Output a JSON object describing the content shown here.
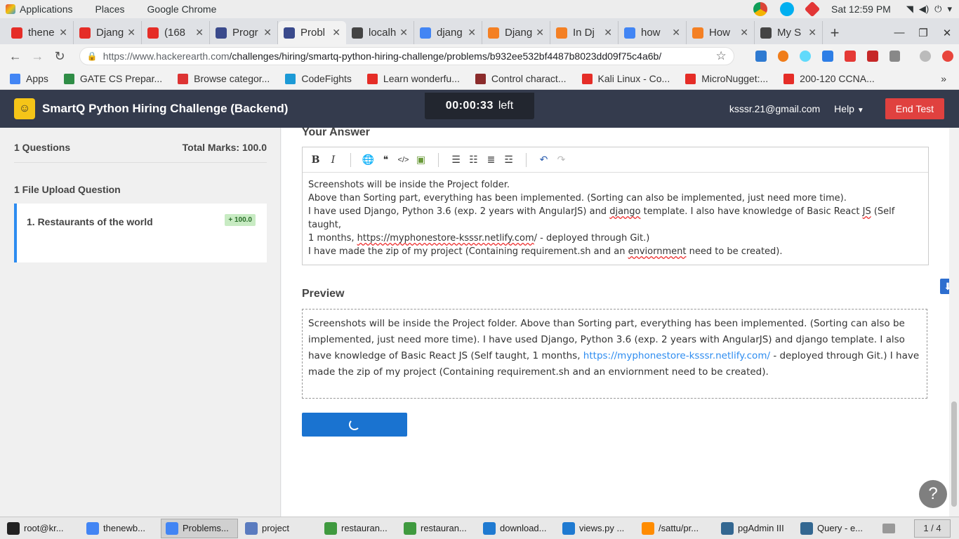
{
  "gnome": {
    "applications": "Applications",
    "places": "Places",
    "app_menu": "Google Chrome",
    "clock": "Sat 12:59 PM"
  },
  "tabs": [
    {
      "title": "thene",
      "color": "#e52d27"
    },
    {
      "title": "Djang",
      "color": "#e52d27"
    },
    {
      "title": "(168",
      "color": "#e52d27"
    },
    {
      "title": "Progr",
      "color": "#3a4a8c"
    },
    {
      "title": "Probl",
      "color": "#3a4a8c"
    },
    {
      "title": "localh",
      "color": "#444444"
    },
    {
      "title": "djang",
      "color": "#4285f4"
    },
    {
      "title": "Djang",
      "color": "#f48024"
    },
    {
      "title": "In Dj",
      "color": "#f48024"
    },
    {
      "title": "how",
      "color": "#4285f4"
    },
    {
      "title": "How",
      "color": "#f48024"
    },
    {
      "title": "My S",
      "color": "#444444"
    }
  ],
  "omnibox": {
    "url_host": "https://www.hackerearth.com",
    "url_path": "/challenges/hiring/smartq-python-hiring-challenge/problems/b932ee532bf4487b8023dd09f75c4a6b/"
  },
  "bookmarks": [
    {
      "label": "Apps",
      "color": "#4285f4"
    },
    {
      "label": "GATE CS Prepar...",
      "color": "#2f8d46"
    },
    {
      "label": "Browse categor...",
      "color": "#d33"
    },
    {
      "label": "CodeFights",
      "color": "#1c9ad6"
    },
    {
      "label": "Learn wonderfu...",
      "color": "#e52d27"
    },
    {
      "label": "Control charact...",
      "color": "#8b2b2b"
    },
    {
      "label": "Kali Linux - Co...",
      "color": "#e52d27"
    },
    {
      "label": "MicroNugget:...",
      "color": "#e52d27"
    },
    {
      "label": "200-120 CCNA...",
      "color": "#e52d27"
    }
  ],
  "header": {
    "title": "SmartQ Python Hiring Challenge (Backend)",
    "timer": "00:00:33",
    "timer_suffix": "left",
    "email": "ksssr.21@gmail.com",
    "help": "Help",
    "end_test": "End Test"
  },
  "sidebar": {
    "questions_count": "1 Questions",
    "total_marks": "Total Marks: 100.0",
    "section": "1 File Upload Question",
    "question": "1. Restaurants of the world",
    "badge": "+ 100.0"
  },
  "main": {
    "your_answer": "Your Answer",
    "preview_heading": "Preview",
    "answer_lines": {
      "l1": "Screenshots will be inside the Project folder.",
      "l2": "Above than Sorting part, everything has been implemented. (Sorting can also be implemented, just need more time).",
      "l3a": "I have used Django, Python 3.6 (exp. 2 years with AngularJS) and ",
      "l3b": "django",
      "l3c": " template. I also have knowledge of Basic React ",
      "l3d": "JS",
      "l3e": " (Self taught,",
      "l4a": "1 months, ",
      "l4b": "https://myphonestore-ksssr.netlify.com",
      "l4c": "/ - deployed through Git.)",
      "l5a": "I have made the zip of my project (Containing requirement.sh and an ",
      "l5b": "enviornment",
      "l5c": " need to be created)."
    },
    "preview_text_a": "Screenshots will be inside the Project folder. Above than Sorting part, everything has been implemented. (Sorting can also be implemented, just need more time). I have used Django, Python 3.6 (exp. 2 years with AngularJS) and django template. I also have knowledge of Basic React JS (Self taught, 1 months, ",
    "preview_link": "https://myphonestore-ksssr.netlify.com/",
    "preview_text_b": " - deployed through Git.) I have made the zip of my project (Containing requirement.sh and an enviornment need to be created)."
  },
  "taskbar": [
    {
      "label": "root@kr...",
      "color": "#222222"
    },
    {
      "label": "thenewb...",
      "color": "#4285f4"
    },
    {
      "label": "Problems...",
      "color": "#4285f4",
      "active": true
    },
    {
      "label": "project",
      "color": "#5a7bbf"
    },
    {
      "label": "restauran...",
      "color": "#3f9a3f"
    },
    {
      "label": "restauran...",
      "color": "#3f9a3f"
    },
    {
      "label": "download...",
      "color": "#1f7ad1"
    },
    {
      "label": "views.py ...",
      "color": "#1f7ad1"
    },
    {
      "label": "/sattu/pr...",
      "color": "#ff8c00"
    },
    {
      "label": "pgAdmin III",
      "color": "#336791"
    },
    {
      "label": "Query - e...",
      "color": "#336791"
    }
  ],
  "workspace": "1 / 4"
}
